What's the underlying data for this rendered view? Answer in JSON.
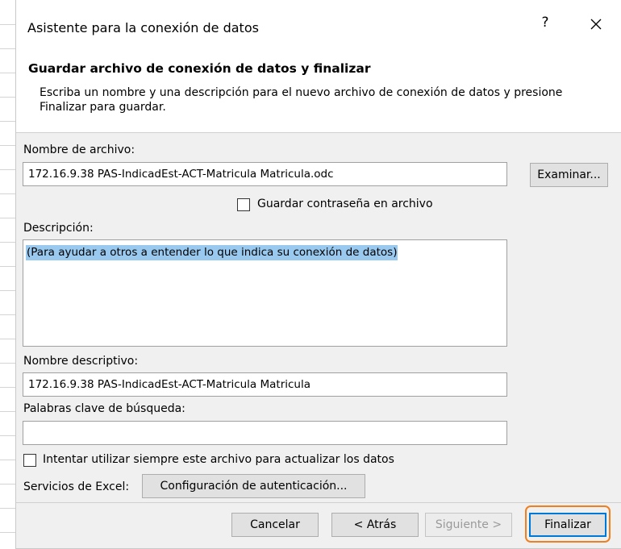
{
  "window": {
    "title": "Asistente para la conexión de datos",
    "help_label": "?"
  },
  "header": {
    "title": "Guardar archivo de conexión de datos y finalizar",
    "description": "Escriba un nombre y una descripción para el nuevo archivo de conexión de datos y presione Finalizar para guardar."
  },
  "form": {
    "filename_label": "Nombre de archivo:",
    "filename_value": "172.16.9.38 PAS-IndicadEst-ACT-Matricula Matricula.odc",
    "browse_label": "Examinar...",
    "save_password_label": "Guardar contraseña en archivo",
    "save_password_checked": false,
    "description_label": "Descripción:",
    "description_value": "(Para ayudar a otros a entender lo que indica su conexión de datos)",
    "friendly_name_label": "Nombre descriptivo:",
    "friendly_name_value": "172.16.9.38 PAS-IndicadEst-ACT-Matricula Matricula",
    "keywords_label": "Palabras clave de búsqueda:",
    "keywords_value": "",
    "always_use_label": "Intentar utilizar siempre este archivo para actualizar los datos",
    "always_use_checked": false,
    "excel_services_label": "Servicios de Excel:",
    "auth_button_label": "Configuración de autenticación..."
  },
  "footer": {
    "cancel_label": "Cancelar",
    "back_label": "< Atrás",
    "next_label": "Siguiente >",
    "finish_label": "Finalizar"
  },
  "colors": {
    "selection": "#99c9ef",
    "focus_outline": "#f07f20",
    "dialog_bg": "#f0f0f0"
  }
}
